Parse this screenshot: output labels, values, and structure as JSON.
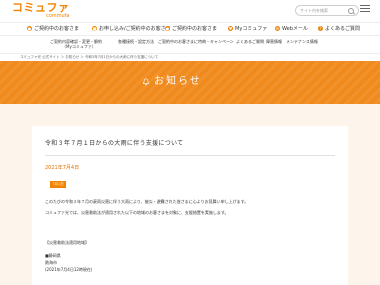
{
  "header": {
    "logo_text": "コミュファ",
    "logo_sub": "commufa",
    "search_placeholder": "サイト内を検索"
  },
  "nav_primary": {
    "items": [
      {
        "icon": "person-icon",
        "label": "ご契約中のお客さま"
      },
      {
        "icon": "document-icon",
        "label": "お申し込み/ご契約中のお客さま"
      },
      {
        "icon": "person-icon",
        "label": "ご契約中のお客さま"
      },
      {
        "icon": "heart-icon",
        "label": "Myコミュファ"
      },
      {
        "icon": "mail-icon",
        "label": "Webメール"
      },
      {
        "icon": "question-icon",
        "label": "よくあるご質問"
      }
    ]
  },
  "nav_secondary": {
    "items": [
      {
        "line1": "ご契約内容確認・変更・解約",
        "line2": "（Myコミュファ）"
      },
      {
        "line1": "各種接続・設定方法",
        "line2": ""
      },
      {
        "line1": "ご契約中のお客さまに特典・キャンペーン",
        "line2": ""
      },
      {
        "line1": "よくあるご質問",
        "line2": ""
      },
      {
        "line1": "障害情報",
        "line2": ""
      },
      {
        "line1": "メンテナンス情報",
        "line2": ""
      }
    ]
  },
  "breadcrumb": "コミュファ光 公式サイト ＞ お知らせ ＞ 令和3年7月1日からの大雨に伴う支援について",
  "banner": {
    "title": "お知らせ"
  },
  "article": {
    "title": "令和３年７月１日からの大雨に伴う支援について",
    "date": "2021年7月4日",
    "badge": "7月1日",
    "paragraphs": [
      "このたびの令和３年７月の豪雨災害に伴う大雨により、被災・避難された皆さまに心よりお見舞い申し上げます。",
      "コミュファ光では、災害救助法が適用された以下の地域のお客さまを対象に、支援措置を実施します。",
      "【災害救助法適用地域】",
      "■静岡県",
      "熱海市",
      "(2021年7月4日12時現在)"
    ]
  },
  "colors": {
    "brand_orange": "#f08300",
    "banner_orange": "#f08a1c",
    "page_bg": "#fdf4ec"
  }
}
